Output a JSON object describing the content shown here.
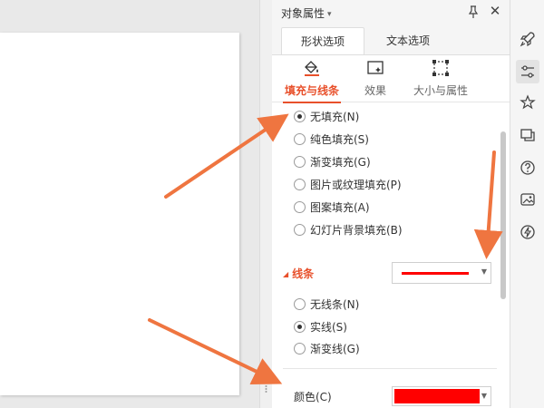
{
  "pane": {
    "title": "对象属性",
    "tabs": [
      "形状选项",
      "文本选项"
    ],
    "subtabs": [
      "填充与线条",
      "效果",
      "大小与属性"
    ]
  },
  "fill": {
    "options": [
      {
        "label": "无填充(N)",
        "checked": true
      },
      {
        "label": "纯色填充(S)",
        "checked": false
      },
      {
        "label": "渐变填充(G)",
        "checked": false
      },
      {
        "label": "图片或纹理填充(P)",
        "checked": false
      },
      {
        "label": "图案填充(A)",
        "checked": false
      },
      {
        "label": "幻灯片背景填充(B)",
        "checked": false
      }
    ]
  },
  "line": {
    "section_title": "线条",
    "options": [
      {
        "label": "无线条(N)",
        "checked": false
      },
      {
        "label": "实线(S)",
        "checked": true
      },
      {
        "label": "渐变线(G)",
        "checked": false
      }
    ],
    "line_color": "#ff0000",
    "color_label": "颜色(C)",
    "color_value": "#ff0000"
  },
  "colors": {
    "accent": "#e8502b",
    "arrow": "#ef7540"
  },
  "sidebar_icons": [
    "rocket-icon",
    "properties-icon",
    "magic-star-icon",
    "transition-icon",
    "help-icon",
    "image-replace-icon",
    "lightning-icon"
  ]
}
